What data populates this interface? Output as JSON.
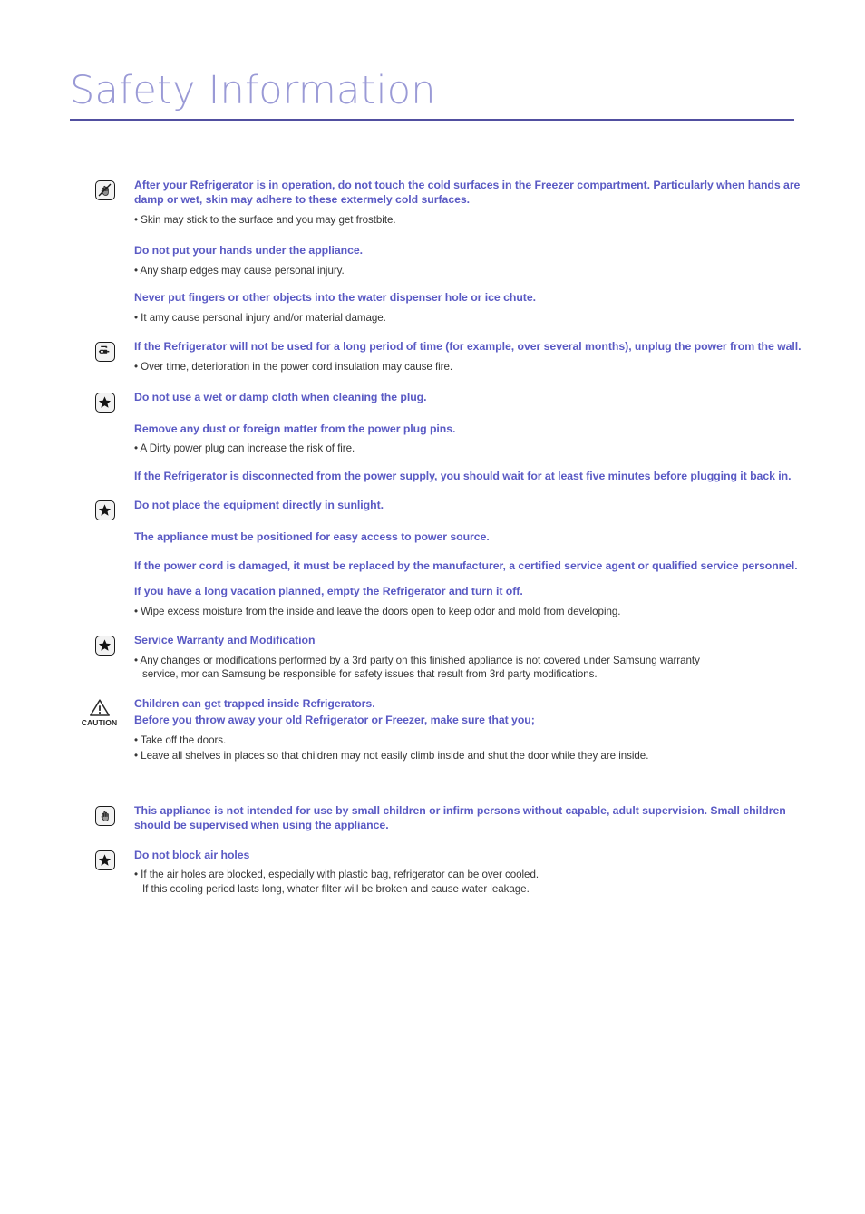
{
  "page": {
    "title": "Safety Information",
    "accent_color": "#5a5ac4",
    "title_color": "#9a9ad6",
    "rule_color": "#514fa0",
    "body_color": "#363636",
    "background": "#ffffff"
  },
  "caution": {
    "label": "CAUTION"
  },
  "sections": [
    {
      "icon": "no-touch-hand-icon",
      "items": [
        {
          "type": "heading",
          "text": "After your Refrigerator is in operation, do not touch the cold surfaces in the Freezer compartment. Particularly when hands are damp or wet, skin may adhere to these extermely cold surfaces."
        },
        {
          "type": "bullet",
          "text": "Skin may stick to the surface and you may get frostbite."
        },
        {
          "type": "heading",
          "text": "Do not put your hands under the appliance."
        },
        {
          "type": "bullet",
          "text": "Any sharp edges may cause personal injury."
        },
        {
          "type": "heading",
          "text": "Never put fingers or other objects into the water dispenser hole or ice chute."
        },
        {
          "type": "bullet",
          "text": "It amy cause personal injury and/or material damage."
        }
      ]
    },
    {
      "icon": "unplug-power-icon",
      "items": [
        {
          "type": "heading",
          "text": "If the Refrigerator will not be used for a long period of time (for example, over several months), unplug the power from the wall."
        },
        {
          "type": "bullet",
          "text": "Over time, deterioration in the power cord insulation may cause fire."
        }
      ]
    },
    {
      "icon": "star-icon",
      "items": [
        {
          "type": "heading",
          "text": "Do not use a wet or damp cloth when cleaning the plug."
        },
        {
          "type": "heading",
          "text": "Remove any dust or foreign matter from the power plug pins."
        },
        {
          "type": "bullet",
          "text": "A Dirty power plug can increase the risk of fire."
        },
        {
          "type": "heading",
          "text": "If the Refrigerator is disconnected from the power supply, you should wait for at least five minutes before plugging it back in."
        }
      ]
    },
    {
      "icon": "star-icon",
      "items": [
        {
          "type": "heading",
          "text": "Do not place the equipment directly in sunlight."
        },
        {
          "type": "heading",
          "text": "The appliance must be positioned for easy access to power source."
        },
        {
          "type": "heading",
          "text": "If the power cord is damaged, it must be replaced by the manufacturer, a certified service agent or qualified service personnel."
        },
        {
          "type": "heading",
          "text": "If you have a long vacation planned, empty the Refrigerator and turn it off."
        },
        {
          "type": "bullet",
          "text": "Wipe excess moisture from the inside and leave the doors open to keep odor and mold from developing."
        }
      ]
    },
    {
      "icon": "star-icon",
      "items": [
        {
          "type": "heading",
          "text": "Service Warranty and Modification"
        },
        {
          "type": "bullet",
          "text": "Any changes or modifications performed by a 3rd party on this finished appliance is not covered under Samsung warranty",
          "continuation": "service, mor can Samsung be responsible for safety issues that result from 3rd party modifications."
        }
      ]
    },
    {
      "icon": "caution-triangle-icon",
      "items": [
        {
          "type": "heading",
          "text": "Children can get trapped inside Refrigerators."
        },
        {
          "type": "heading",
          "text": "Before you throw away your old Refrigerator or Freezer, make sure that you;"
        },
        {
          "type": "bullet",
          "text": "Take off the doors."
        },
        {
          "type": "bullet",
          "text": "Leave all shelves in places so that children may not easily climb inside and shut the door while they are inside."
        }
      ]
    },
    {
      "icon": "hand-supervision-icon",
      "items": [
        {
          "type": "heading",
          "text": "This appliance is not intended for use by small children or infirm persons without capable, adult supervision. Small children should be supervised when using the appliance."
        }
      ]
    },
    {
      "icon": "star-icon",
      "items": [
        {
          "type": "heading",
          "text": "Do not block air holes"
        },
        {
          "type": "bullet",
          "text": "If the air holes are blocked, especially with plastic bag, refrigerator can be over cooled.",
          "continuation": "If this cooling period lasts long, whater filter will be broken and cause water leakage."
        }
      ]
    }
  ]
}
